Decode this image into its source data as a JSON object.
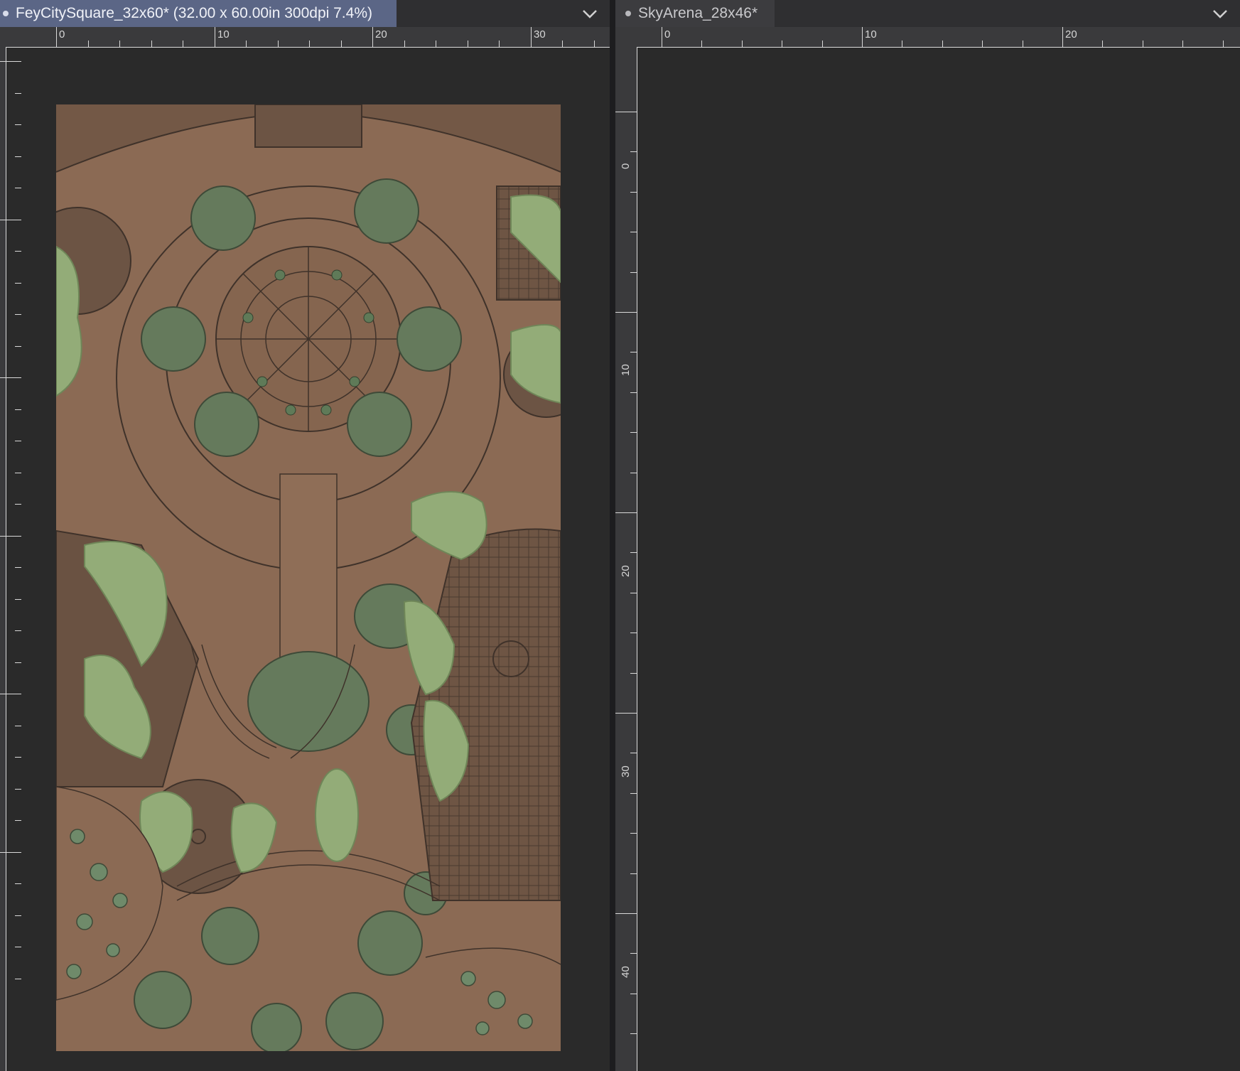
{
  "left_document": {
    "tab_title": "FeyCitySquare_32x60* (32.00 x 60.00in 300dpi 7.4%)",
    "ruler_h_labels": [
      "0",
      "10",
      "20",
      "30"
    ]
  },
  "right_document": {
    "tab_title": "SkyArena_28x46*",
    "ruler_h_labels": [
      "0",
      "10",
      "20"
    ],
    "ruler_v_labels": [
      "0",
      "10",
      "20",
      "30",
      "40"
    ]
  },
  "icons": {
    "tab_menu": "chevron-down-icon",
    "modified_marker": "dot-icon"
  },
  "colors": {
    "active_tab": "#5b6686",
    "inactive_tab": "#3c3c3f",
    "workspace": "#2a2a2a",
    "left_canvas_ground": "#8b6a54",
    "left_canvas_tree_dark": "#657a5c",
    "left_canvas_tree_light": "#93ac78",
    "right_canvas_bg": "#8dbab2",
    "right_grid": "#a9cdc7",
    "sketch_red": "#e05a5a",
    "guide_purple": "#7a4ed6"
  }
}
